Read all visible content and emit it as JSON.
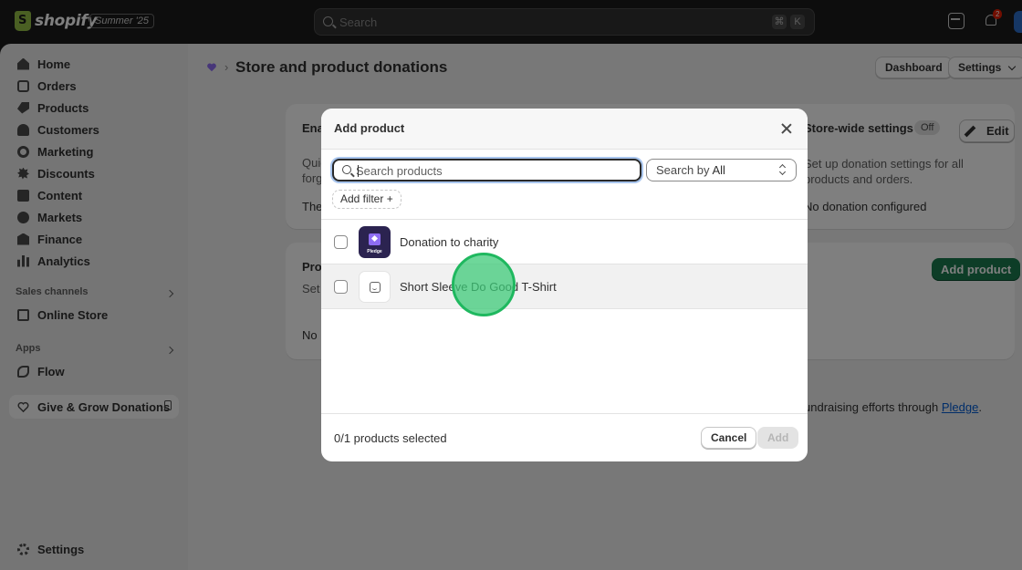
{
  "topbar": {
    "logo_text": "shopify",
    "edition_badge": "Summer '25",
    "search_placeholder": "Search",
    "shortcut_keys": [
      "⌘",
      "K"
    ],
    "notification_count": "2"
  },
  "sidebar": {
    "items": [
      {
        "label": "Home",
        "icon": "home-icon"
      },
      {
        "label": "Orders",
        "icon": "orders-icon"
      },
      {
        "label": "Products",
        "icon": "products-tag-icon"
      },
      {
        "label": "Customers",
        "icon": "person-icon"
      },
      {
        "label": "Marketing",
        "icon": "target-icon"
      },
      {
        "label": "Discounts",
        "icon": "discount-icon"
      },
      {
        "label": "Content",
        "icon": "content-icon"
      },
      {
        "label": "Markets",
        "icon": "globe-icon"
      },
      {
        "label": "Finance",
        "icon": "bank-icon"
      },
      {
        "label": "Analytics",
        "icon": "bar-chart-icon"
      }
    ],
    "sales_channels_label": "Sales channels",
    "online_store_label": "Online Store",
    "apps_label": "Apps",
    "flow_label": "Flow",
    "active_app_label": "Give & Grow Donations",
    "settings_label": "Settings"
  },
  "page": {
    "title": "Store and product donations",
    "dashboard_button": "Dashboard",
    "settings_button": "Settings",
    "card1": {
      "title_fragment": "Ena",
      "line1_fragment": "Quic",
      "line2_fragment": "forg",
      "line3_fragment": "The"
    },
    "store_wide": {
      "title": "Store-wide settings",
      "status_badge": "Off",
      "edit_button": "Edit",
      "description": "Set up donation settings for all products and orders.",
      "status_text": "No donation configured"
    },
    "card2": {
      "title_fragment": "Prod",
      "line1_fragment": "Set",
      "line2_fragment": "No p",
      "add_product_button": "Add product"
    },
    "footer_text": "undraising efforts through",
    "footer_link": "Pledge",
    "footer_end": "."
  },
  "modal": {
    "title": "Add product",
    "search_placeholder": "Search products",
    "search_by_label": "Search by",
    "search_by_value": "All",
    "add_filter_label": "Add filter +",
    "products": [
      {
        "name": "Donation to charity",
        "thumbnail_text": "Pledge"
      },
      {
        "name": "Short Sleeve Do Good T-Shirt"
      }
    ],
    "selected_count": "0/1 products selected",
    "cancel_button": "Cancel",
    "add_button": "Add"
  },
  "colors": {
    "primary_button": "#1a7a4e",
    "link": "#005bd3",
    "click_indicator": "#3ec978"
  }
}
